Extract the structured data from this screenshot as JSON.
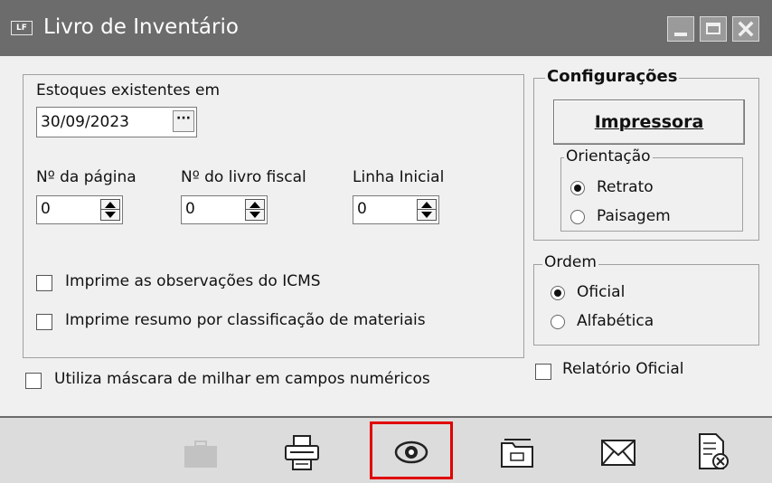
{
  "window": {
    "icon_text": "LF",
    "title": "Livro de Inventário",
    "controls": [
      "minimize",
      "maximize",
      "close"
    ]
  },
  "stock": {
    "label": "Estoques existentes em",
    "date_value": "30/09/2023",
    "date_button": "···"
  },
  "spinners": [
    {
      "label": "Nº da página",
      "value": "0"
    },
    {
      "label": "Nº do livro fiscal",
      "value": "0"
    },
    {
      "label": "Linha Inicial",
      "value": "0"
    }
  ],
  "options": {
    "icms": {
      "label": "Imprime as observações do ICMS",
      "checked": false
    },
    "resumo": {
      "label": "Imprime resumo por classificação de materiais",
      "checked": false
    },
    "mascara": {
      "label": "Utiliza máscara de milhar em campos numéricos",
      "checked": false
    },
    "relatorio_oficial": {
      "label": "Relatório Oficial",
      "checked": false
    }
  },
  "config": {
    "title": "Configurações",
    "printer_button": "Impressora",
    "orientation": {
      "legend": "Orientação",
      "options": [
        {
          "label": "Retrato",
          "selected": true
        },
        {
          "label": "Paisagem",
          "selected": false
        }
      ]
    }
  },
  "order": {
    "legend": "Ordem",
    "options": [
      {
        "label": "Oficial",
        "selected": true
      },
      {
        "label": "Alfabética",
        "selected": false
      }
    ]
  },
  "toolbar": {
    "icons": [
      "briefcase-icon",
      "printer-icon",
      "preview-eye-icon",
      "folder-icon",
      "envelope-icon",
      "close-document-icon"
    ],
    "highlighted": "preview-eye-icon",
    "highlight_color": "#e00000"
  },
  "colors": {
    "titlebar": "#6c6c6c",
    "window_bg": "#f0f0f0",
    "toolbar_bg": "#dcdcdc"
  }
}
